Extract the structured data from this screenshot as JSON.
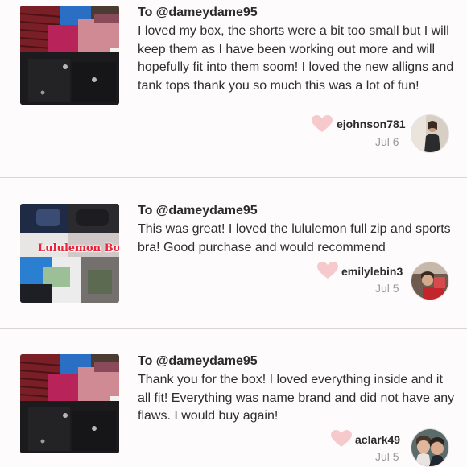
{
  "reviews": [
    {
      "to": "To @dameydame95",
      "body": "I loved my box, the shorts were a bit too small but I will keep them as I have been working out more and will hopefully fit into them soom! I loved the new alligns and tank tops thank you so much this was a lot of fun!",
      "username": "ejohnson781",
      "date": "Jul 6",
      "photo_icon": "clothing-bundle-photo",
      "avatar_icon": "user-avatar"
    },
    {
      "to": "To @dameydame95",
      "body": "This was great! I loved the lululemon full zip and sports bra! Good purchase and would recommend",
      "username": "emilylebin3",
      "date": "Jul 5",
      "photo_icon": "clothing-bundle-photo",
      "photo_caption": "Lululemon Box",
      "avatar_icon": "user-avatar"
    },
    {
      "to": "To @dameydame95",
      "body": "Thank you for the box! I loved everything inside and it all fit! Everything was name brand and did not have any flaws. I would buy again!",
      "username": "aclark49",
      "date": "Jul 5",
      "photo_icon": "clothing-bundle-photo",
      "avatar_icon": "user-avatar"
    }
  ],
  "colors": {
    "heart": "#f6c9cc",
    "divider": "#d9d5d5",
    "date": "#9a9a9a",
    "text": "#2b2b2b",
    "caption": "#e8233a"
  }
}
